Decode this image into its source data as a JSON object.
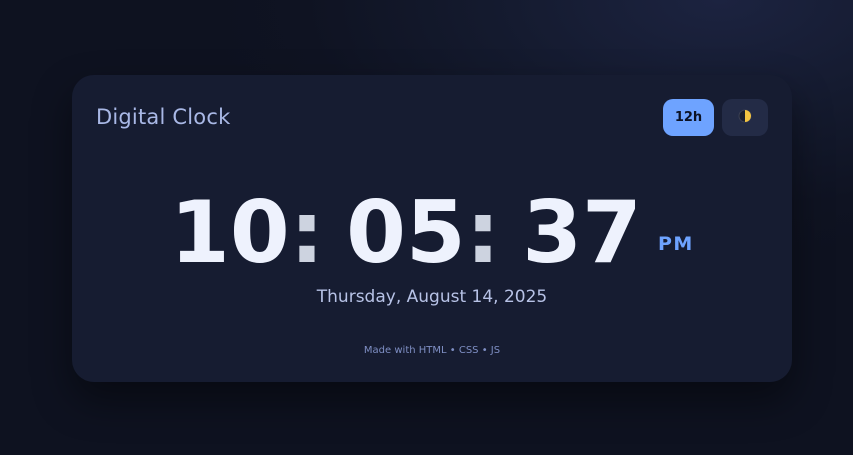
{
  "app": {
    "title": "Digital Clock"
  },
  "controls": {
    "format_label": "12h",
    "theme_icon": "half-moon-icon"
  },
  "clock": {
    "hours": "10",
    "minutes": "05",
    "seconds": "37",
    "separator": ":",
    "meridiem": "PM",
    "date": "Thursday, August 14, 2025"
  },
  "footer": {
    "text": "Made with HTML • CSS • JS"
  },
  "colors": {
    "accent": "#6ea3ff",
    "card": "#161c31",
    "background": "#0f1322",
    "digits": "#eef2fd"
  }
}
